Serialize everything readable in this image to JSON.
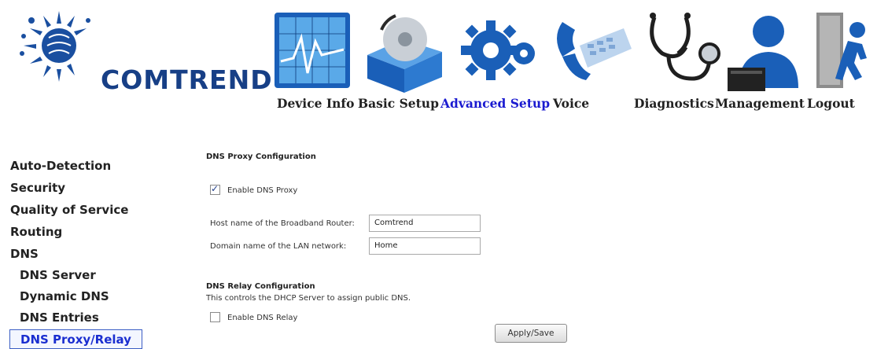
{
  "brand": {
    "name": "COMTREND",
    "accent": "#173f86",
    "logo_color": "#1a4fa0"
  },
  "nav": {
    "items": [
      {
        "label": "Device Info",
        "icon": "device-info-icon"
      },
      {
        "label": "Basic Setup",
        "icon": "basic-setup-icon"
      },
      {
        "label": "Advanced Setup",
        "icon": "advanced-setup-icon",
        "active": true
      },
      {
        "label": "Voice",
        "icon": "voice-icon"
      },
      {
        "label": "Diagnostics",
        "icon": "diagnostics-icon"
      },
      {
        "label": "Management",
        "icon": "management-icon"
      },
      {
        "label": "Logout",
        "icon": "logout-icon"
      }
    ]
  },
  "sidebar": {
    "items": [
      {
        "label": "Auto-Detection"
      },
      {
        "label": "Security"
      },
      {
        "label": "Quality of Service"
      },
      {
        "label": "Routing"
      },
      {
        "label": "DNS"
      },
      {
        "label": "DNS Server"
      },
      {
        "label": "Dynamic DNS"
      },
      {
        "label": "DNS Entries"
      },
      {
        "label": "DNS Proxy/Relay",
        "selected": true
      }
    ]
  },
  "proxy": {
    "title": "DNS Proxy Configuration",
    "enable_label": "Enable DNS Proxy",
    "enable_checked": true,
    "host_label": "Host name of the Broadband Router:",
    "host_value": "Comtrend",
    "domain_label": "Domain name of the LAN network:",
    "domain_value": "Home"
  },
  "relay": {
    "title": "DNS Relay Configuration",
    "description": "This controls the DHCP Server to assign public DNS.",
    "enable_label": "Enable DNS Relay",
    "enable_checked": false
  },
  "actions": {
    "apply_label": "Apply/Save"
  }
}
